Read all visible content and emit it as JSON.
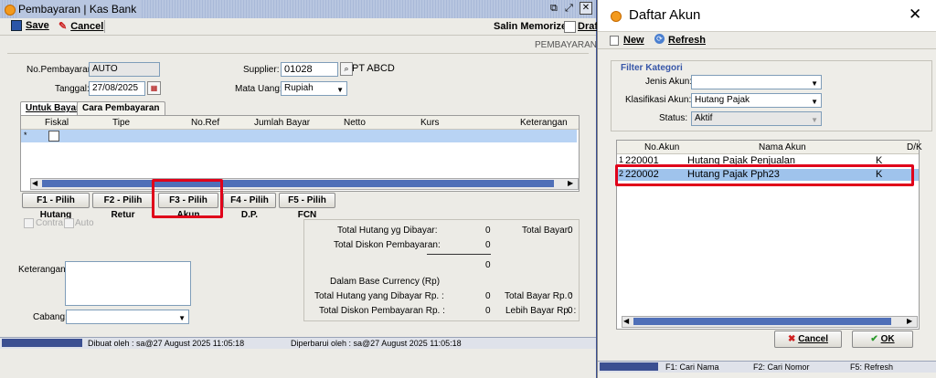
{
  "left_window": {
    "title": "Pembayaran | Kas Bank",
    "toolbar": {
      "save": "Save",
      "cancel": "Cancel",
      "salin_memorized": "Salin Memorized",
      "draft": "Draft"
    },
    "section_label": "PEMBAYARAN",
    "form": {
      "no_pembayaran_label": "No.Pembayaran:",
      "no_pembayaran_value": "AUTO",
      "tanggal_label": "Tanggal:",
      "tanggal_value": "27/08/2025",
      "supplier_label": "Supplier:",
      "supplier_code": "01028",
      "supplier_name": "PT ABCD",
      "mata_uang_label": "Mata Uang:",
      "mata_uang_value": "Rupiah"
    },
    "tabs": [
      "Untuk Bayar",
      "Cara Pembayaran"
    ],
    "grid_columns": [
      "Fiskal",
      "Tipe",
      "No.Ref",
      "Jumlah Bayar",
      "Netto",
      "Kurs",
      "Keterangan"
    ],
    "grid_row_marker": "*",
    "action_buttons": [
      "F1 - Pilih Hutang",
      "F2 - Pilih Retur",
      "F3 - Pilih Akun",
      "F4 - Pilih D.P.",
      "F5 - Pilih FCN"
    ],
    "checks": {
      "contra": "Contra",
      "auto": "Auto"
    },
    "keterangan_label": "Keterangan:",
    "cabang_label": "Cabang:",
    "summary": {
      "total_hutang_label": "Total Hutang yg Dibayar:",
      "total_hutang_value": "0",
      "total_bayar_label": "Total Bayar:",
      "total_bayar_value": "0",
      "total_diskon_label": "Total Diskon Pembayaran:",
      "total_diskon_value": "0",
      "subtotal_value": "0",
      "base_currency_label": "Dalam Base Currency (Rp)",
      "total_hutang_rp_label": "Total Hutang yang Dibayar Rp. :",
      "total_hutang_rp_value": "0",
      "total_bayar_rp_label": "Total Bayar Rp. :",
      "total_bayar_rp_value": "0",
      "total_diskon_rp_label": "Total Diskon Pembayaran Rp. :",
      "total_diskon_rp_value": "0",
      "lebih_bayar_label": "Lebih Bayar Rp. :",
      "lebih_bayar_value": "0"
    },
    "status": {
      "dibuat": "Dibuat oleh : sa@27 August 2025  11:05:18",
      "diperbarui": "Diperbarui oleh : sa@27 August 2025  11:05:18"
    }
  },
  "right_window": {
    "title": "Daftar Akun",
    "toolbar": {
      "new": "New",
      "refresh": "Refresh"
    },
    "filter": {
      "heading": "Filter Kategori",
      "jenis_label": "Jenis Akun:",
      "jenis_value": "",
      "klasifikasi_label": "Klasifikasi Akun:",
      "klasifikasi_value": "Hutang Pajak",
      "status_label": "Status:",
      "status_value": "Aktif"
    },
    "columns": [
      "No.Akun",
      "Nama Akun",
      "D/K"
    ],
    "rows": [
      {
        "num": "1",
        "no_akun": "220001",
        "nama": "Hutang Pajak Penjualan",
        "dk": "K"
      },
      {
        "num": "2",
        "no_akun": "220002",
        "nama": "Hutang Pajak Pph23",
        "dk": "K"
      }
    ],
    "buttons": {
      "cancel": "Cancel",
      "ok": "OK"
    },
    "status": {
      "f1": "F1: Cari Nama",
      "f2": "F2: Cari Nomor",
      "f5": "F5: Refresh"
    }
  },
  "colors": {
    "highlight": "#e0001a",
    "selected_row": "#9fc3ec",
    "statusbar": "#3b4f91"
  }
}
